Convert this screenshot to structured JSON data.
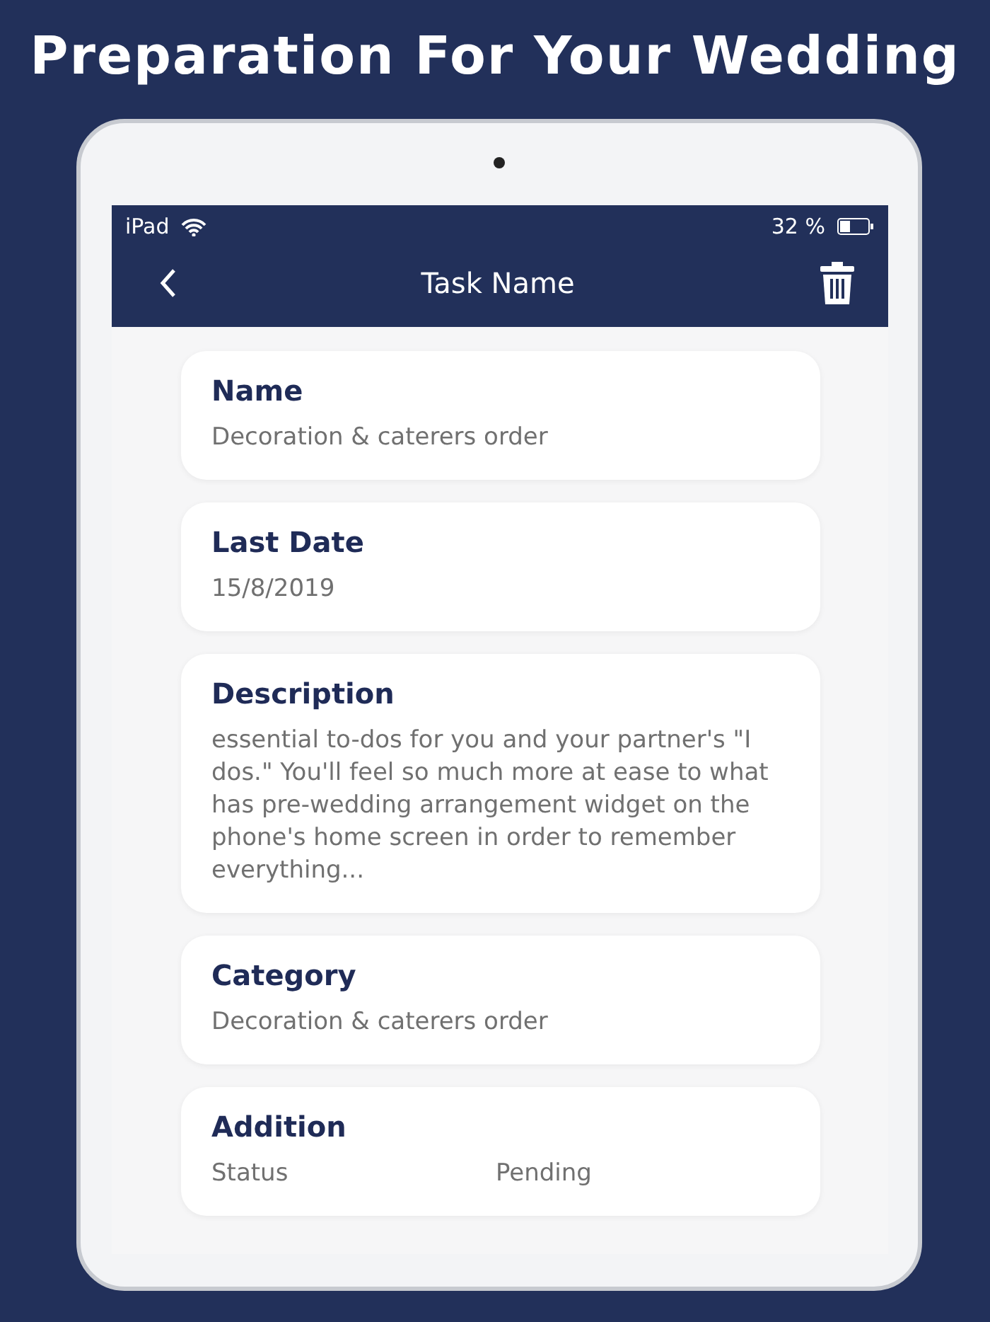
{
  "headline": "Preparation For Your Wedding",
  "status_bar": {
    "device": "iPad",
    "battery": "32 %"
  },
  "nav": {
    "title": "Task Name"
  },
  "cards": [
    {
      "kind": "field",
      "title": "Name",
      "value": "Decoration & caterers order"
    },
    {
      "kind": "field",
      "title": "Last Date",
      "value": "15/8/2019"
    },
    {
      "kind": "field",
      "title": "Description",
      "value": "essential to-dos for you and your partner's \"I dos.\" You'll feel so much more at ease to what has pre-wedding arrangement widget on the phone's home screen in order to remember everything..."
    },
    {
      "kind": "field",
      "title": "Category",
      "value": "Decoration & caterers order"
    },
    {
      "kind": "rows",
      "title": "Addition",
      "rows": [
        {
          "label": "Status",
          "value": "Pending"
        }
      ]
    }
  ]
}
